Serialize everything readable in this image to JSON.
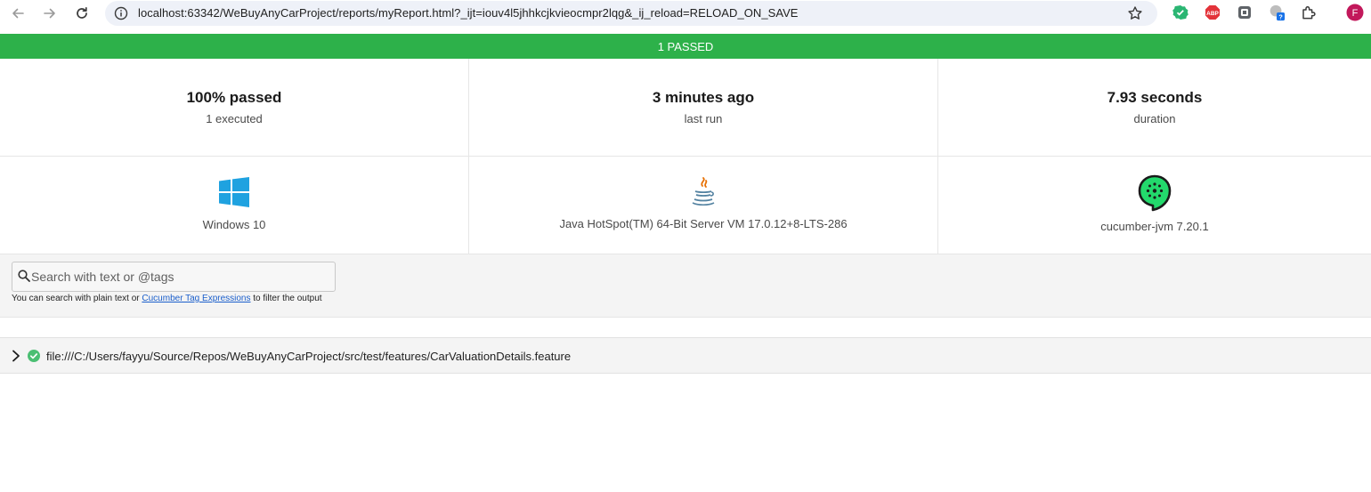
{
  "browser": {
    "url": "localhost:63342/WeBuyAnyCarProject/reports/myReport.html?_ijt=iouv4l5jhhkcjkvieocmpr2lqg&_ij_reload=RELOAD_ON_SAVE",
    "profile_initial": "F",
    "abp_label": "ABP",
    "colors": {
      "omnibox": "#eef1f8",
      "profile": "#c2185b"
    }
  },
  "status": {
    "text": "1 PASSED",
    "color": "#2db14a"
  },
  "stats": [
    {
      "value": "100% passed",
      "label": "1 executed"
    },
    {
      "value": "3 minutes ago",
      "label": "last run"
    },
    {
      "value": "7.93 seconds",
      "label": "duration"
    }
  ],
  "environment": [
    {
      "icon": "windows-icon",
      "label": "Windows 10"
    },
    {
      "icon": "java-icon",
      "label": "Java HotSpot(TM) 64-Bit Server VM 17.0.12+8-LTS-286"
    },
    {
      "icon": "cucumber-icon",
      "label": "cucumber-jvm 7.20.1"
    }
  ],
  "search": {
    "placeholder": "Search with text or @tags",
    "help_prefix": "You can search with plain text or ",
    "help_link": "Cucumber Tag Expressions",
    "help_suffix": " to filter the output"
  },
  "features": [
    {
      "path": "file:///C:/Users/fayyu/Source/Repos/WeBuyAnyCarProject/src/test/features/CarValuationDetails.feature",
      "status": "passed"
    }
  ]
}
